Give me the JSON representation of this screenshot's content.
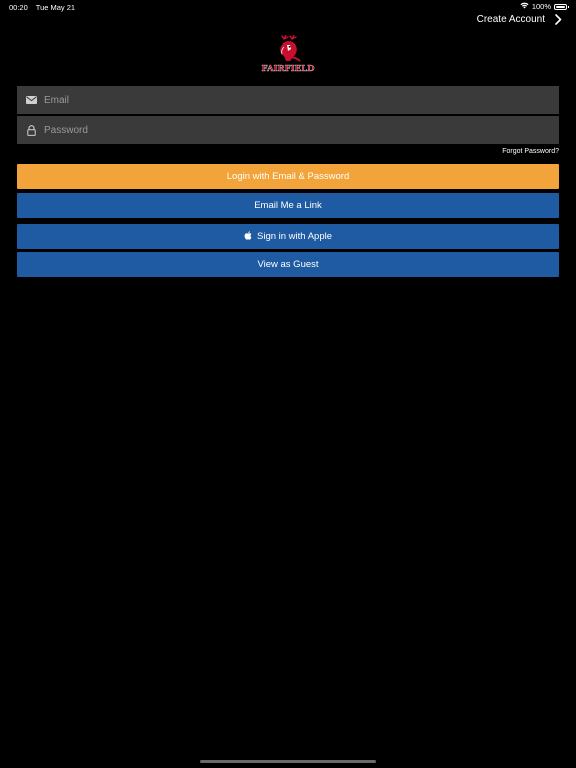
{
  "status_bar": {
    "time": "00:20",
    "date": "Tue May 21",
    "battery": "100%"
  },
  "header": {
    "create_account_label": "Create Account"
  },
  "logo": {
    "text": "FAIRFIELD"
  },
  "form": {
    "email_placeholder": "Email",
    "password_placeholder": "Password",
    "forgot_password_label": "Forgot Password?"
  },
  "buttons": {
    "login_label": "Login with Email & Password",
    "email_link_label": "Email Me a Link",
    "apple_label": "Sign in with Apple",
    "guest_label": "View as Guest"
  },
  "colors": {
    "background": "#000000",
    "field_background": "#3a3a3a",
    "login_button": "#f2a33a",
    "secondary_button": "#1f5ba3",
    "logo_red": "#c8102e"
  }
}
